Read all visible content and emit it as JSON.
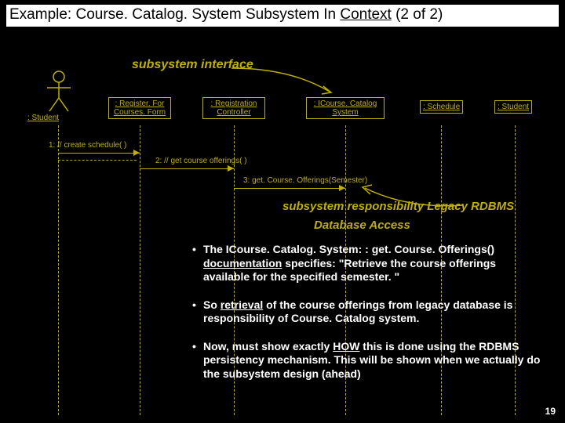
{
  "title_prefix": "Example: Course. Catalog. System Subsystem In ",
  "title_context": "Context",
  "title_suffix": "  (2 of 2)",
  "subsystem_interface_label": "subsystem interface",
  "actor_label": ": Student",
  "boxes": {
    "register_form": ": Register. For\nCourses. Form",
    "registration_controller": ": Registration\nController",
    "icourse_catalog": ": ICourse. Catalog\nSystem",
    "schedule": ": Schedule",
    "student": ": Student"
  },
  "messages": {
    "m1": "1: // create schedule( )",
    "m2": "2: // get course offerings( )",
    "m3": "3: get. Course. Offerings(Semester)"
  },
  "responsibility_line1": "subsystem responsibility Legacy RDBMS",
  "responsibility_line2": "Database Access",
  "bullets": [
    {
      "pre": "The ICourse. Catalog. System: : get. Course. Offerings() ",
      "uword": "documentation",
      "post": " specifies:  \"Retrieve the course offerings available for the specified semester. \""
    },
    {
      "pre": "So ",
      "uword": "retrieval",
      "post": " of the course offerings from  legacy database is responsibility of  Course. Catalog system."
    },
    {
      "pre": "Now, must show exactly ",
      "uword": "HOW",
      "post": " this is done using the RDBMS persistency mechanism. This will be shown when we actually do the subsystem design (ahead)"
    }
  ],
  "page_number": "19"
}
